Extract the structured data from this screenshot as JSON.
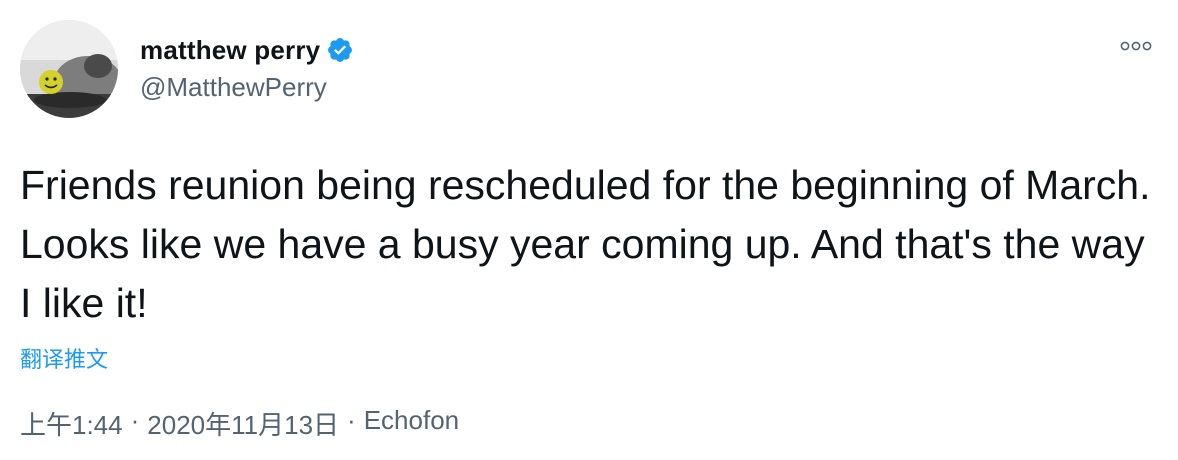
{
  "author": {
    "display_name": "matthew perry",
    "handle": "@MatthewPerry",
    "verified": true,
    "avatar_icon": "profile-photo-with-smiley-ball",
    "verified_icon": "verified-badge-icon",
    "verified_color": "#1d9bf0"
  },
  "more_icon": "more-options-icon",
  "tweet": {
    "text": "Friends reunion being rescheduled for the beginning of March. Looks like we have a busy year coming up. And that's the way I like it!",
    "translate_label": "翻译推文"
  },
  "meta": {
    "time": "上午1:44",
    "separator": "·",
    "date": "2020年11月13日",
    "source": "Echofon"
  },
  "colors": {
    "accent": "#1d9bf0",
    "secondary_text": "#536471",
    "primary_text": "#0f1419"
  }
}
